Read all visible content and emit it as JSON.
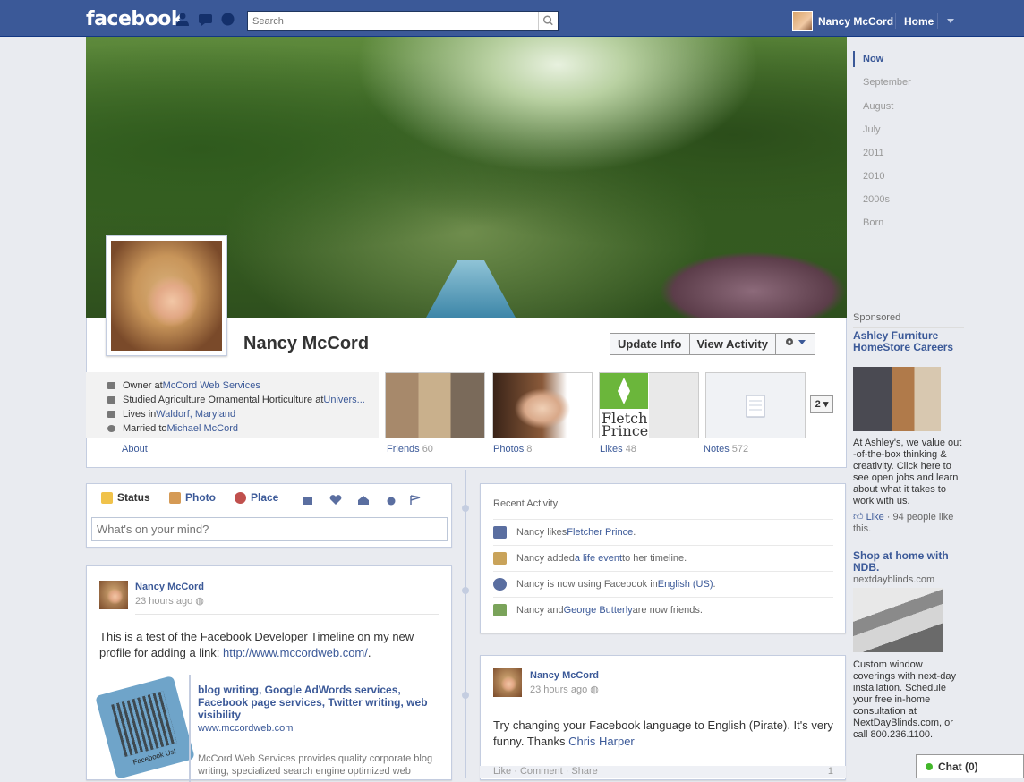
{
  "topbar": {
    "logo": "facebook",
    "search_placeholder": "Search",
    "user_name": "Nancy McCord",
    "home_label": "Home"
  },
  "profile": {
    "name": "Nancy McCord",
    "update_info": "Update Info",
    "view_activity": "View Activity",
    "info": [
      {
        "prefix": "Owner at ",
        "link": "McCord Web Services",
        "suffix": ""
      },
      {
        "prefix": "Studied Agriculture Ornamental Horticulture at ",
        "link": "Univers...",
        "suffix": ""
      },
      {
        "prefix": "Lives in ",
        "link": "Waldorf, Maryland",
        "suffix": ""
      },
      {
        "prefix": "Married to ",
        "link": "Michael McCord",
        "suffix": ""
      }
    ],
    "about": "About",
    "tiles": [
      {
        "label": "Friends",
        "count": "60"
      },
      {
        "label": "Photos",
        "count": "8"
      },
      {
        "label": "Likes",
        "count": "48"
      },
      {
        "label": "Notes",
        "count": "572"
      }
    ],
    "more_count": "2"
  },
  "composer": {
    "tabs": [
      "Status",
      "Photo",
      "Place"
    ],
    "placeholder": "What's on your mind?"
  },
  "post1": {
    "author": "Nancy McCord",
    "time": "23 hours ago",
    "text": "This is a test of the Facebook Developer Timeline on my new profile for adding a link: ",
    "link": "http://www.mccordweb.com/",
    "text_end": ".",
    "link_title": "blog writing, Google AdWords services, Facebook page services, Twitter writing, web visibility",
    "link_url": "www.mccordweb.com",
    "link_desc": "McCord Web Services provides quality corporate blog writing, specialized search engine optimized web",
    "thumb_text": "Facebook Us!"
  },
  "recent": {
    "title": "Recent Activity",
    "items": [
      {
        "prefix": "Nancy likes ",
        "link": "Fletcher Prince",
        "suffix": "."
      },
      {
        "prefix": "Nancy added ",
        "link": "a life event",
        "suffix": " to her timeline."
      },
      {
        "prefix": "Nancy is now using Facebook in ",
        "link": "English (US)",
        "suffix": "."
      },
      {
        "prefix": "Nancy and ",
        "link": "George Butterly",
        "suffix": " are now friends."
      }
    ]
  },
  "post2": {
    "author": "Nancy McCord",
    "time": "23 hours ago",
    "text": "Try changing your Facebook language to English (Pirate). It's very funny. Thanks ",
    "link": "Chris Harper",
    "actions": "Like · Comment · Share",
    "like_count": "1"
  },
  "timeline_nav": [
    "Now",
    "September",
    "August",
    "July",
    "2011",
    "2010",
    "2000s",
    "Born"
  ],
  "sponsored": {
    "heading": "Sponsored",
    "ad1": {
      "title": "Ashley Furniture HomeStore Careers",
      "body": "At Ashley's, we value out -of-the-box thinking & creativity. Click here to see open jobs and learn about what it takes to work with us.",
      "like": "Like",
      "like_count": " · 94 people like this."
    },
    "ad2": {
      "title": "Shop at home with NDB.",
      "sub": "nextdayblinds.com",
      "body": "Custom window coverings with next-day installation. Schedule your free in-home consultation at NextDayBlinds.com, or call 800.236.1100."
    }
  },
  "chat": {
    "label": "Chat",
    "count": "(0)"
  },
  "colors": {
    "brand": "#3b5998",
    "link": "#3b5998",
    "bg": "#e9ebf0"
  }
}
